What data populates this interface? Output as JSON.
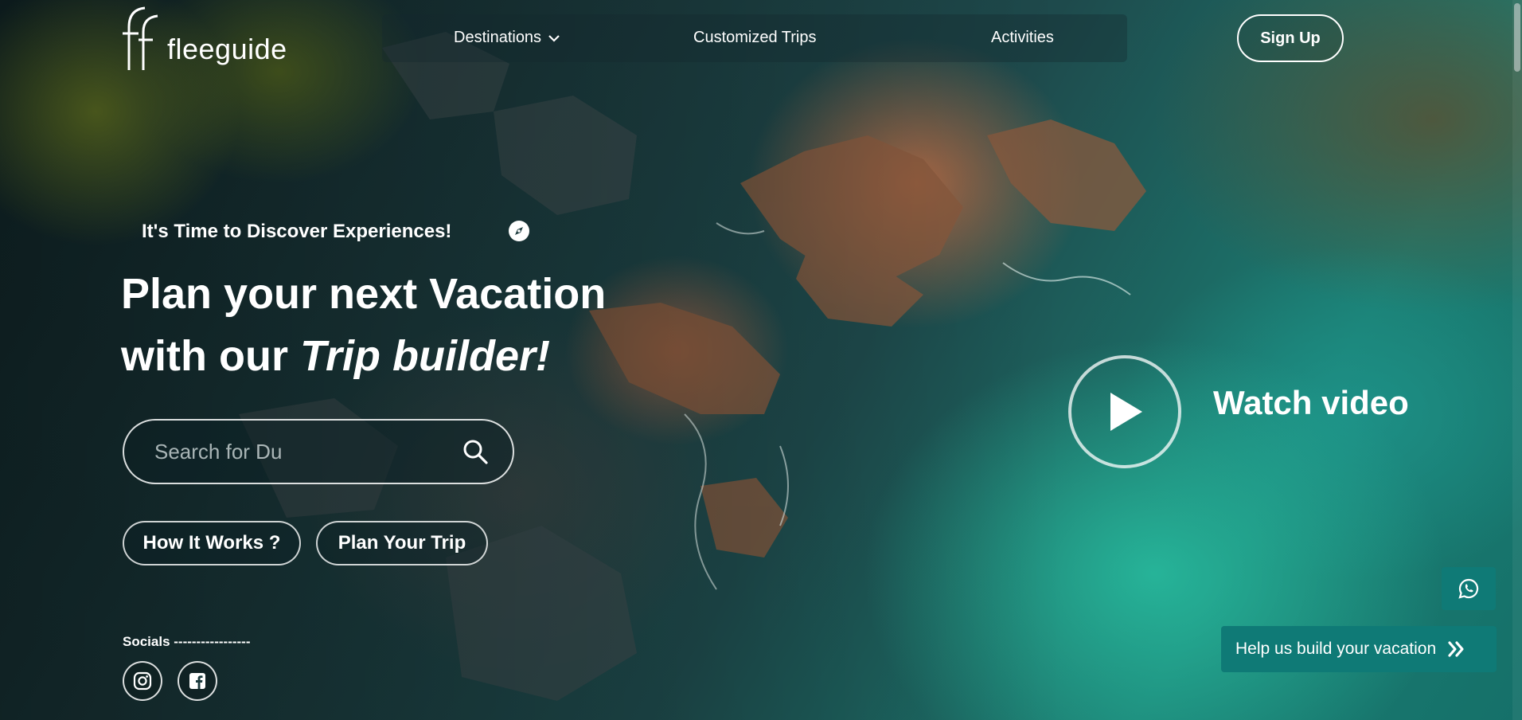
{
  "brand": {
    "name": "fleeguide"
  },
  "nav": {
    "items": [
      {
        "label": "Destinations",
        "has_dropdown": true
      },
      {
        "label": "Customized Trips"
      },
      {
        "label": "Activities"
      }
    ],
    "signup_label": "Sign Up"
  },
  "hero": {
    "tagline": "It's Time to Discover Experiences!",
    "headline_line1": "Plan your next Vacation",
    "headline_line2_prefix": "with our ",
    "headline_line2_italic": "Trip builder!",
    "search": {
      "placeholder": "Search for Du",
      "value": ""
    },
    "buttons": {
      "how_it_works": "How It Works ?",
      "plan_trip": "Plan Your Trip"
    }
  },
  "socials": {
    "label": "Socials -----------------",
    "icons": [
      "instagram-icon",
      "facebook-icon"
    ]
  },
  "video": {
    "label": "Watch video"
  },
  "widgets": {
    "whatsapp_icon": "whatsapp-icon",
    "help_label": "Help us build your vacation"
  },
  "colors": {
    "accent": "#0f7a76",
    "text": "#ffffff"
  }
}
